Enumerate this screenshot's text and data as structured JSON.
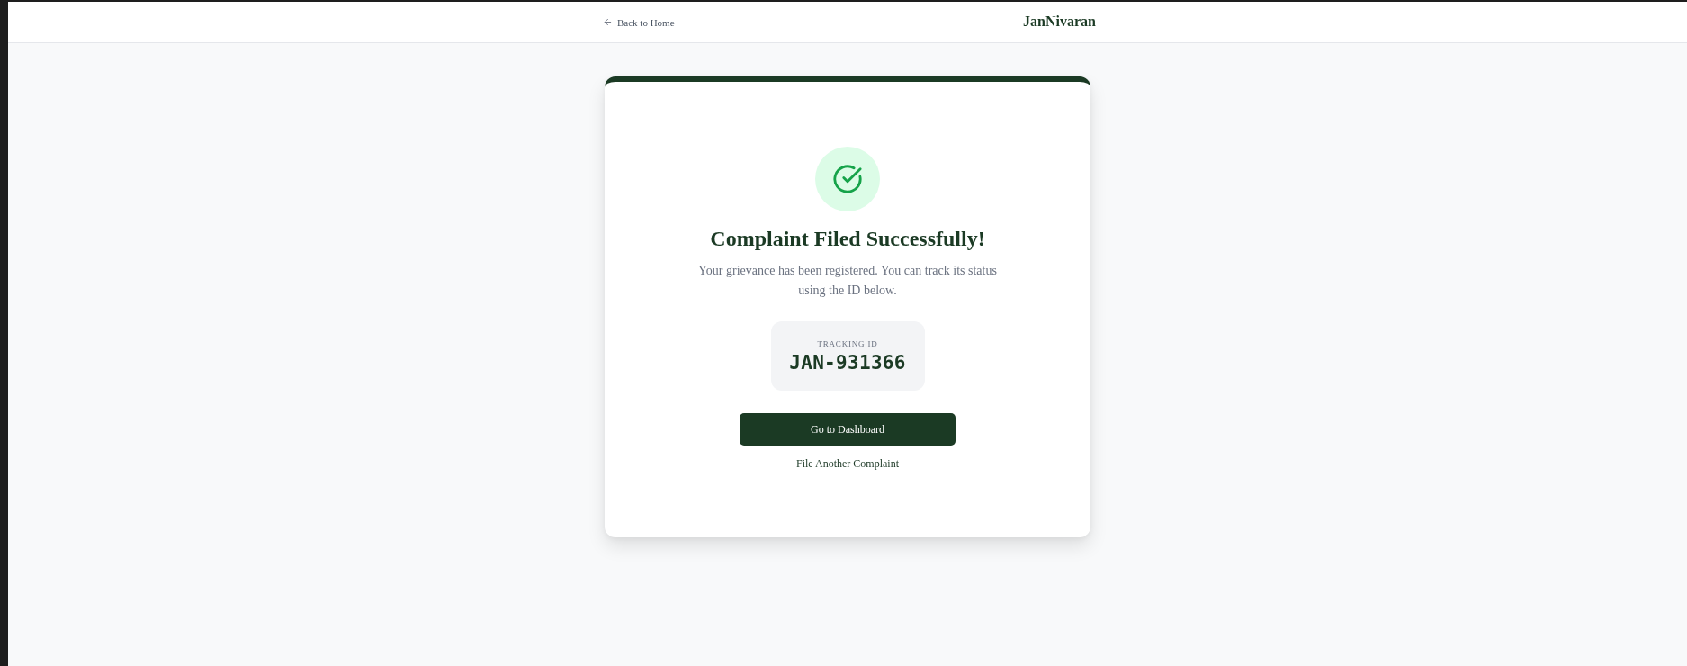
{
  "header": {
    "back_link": "Back to Home",
    "logo": "JanNivaran"
  },
  "card": {
    "title": "Complaint Filed Successfully!",
    "message": "Your grievance has been registered. You can track its status using the ID below.",
    "tracking": {
      "label": "TRACKING ID",
      "id": "JAN-931366"
    },
    "primary_button": "Go to Dashboard",
    "secondary_link": "File Another Complaint"
  }
}
